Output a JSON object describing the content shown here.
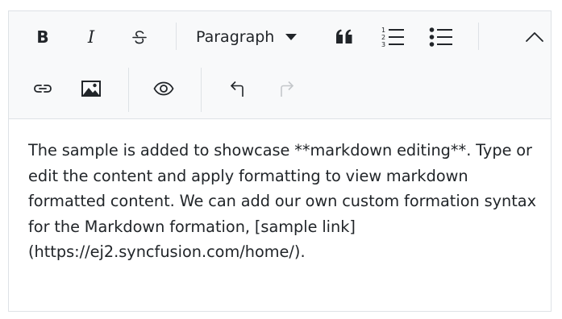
{
  "toolbar": {
    "bold": {
      "icon": "bold-icon",
      "glyph": "B"
    },
    "italic": {
      "icon": "italic-icon",
      "glyph": "I"
    },
    "strikethrough": {
      "icon": "strikethrough-icon"
    },
    "format": {
      "label": "Paragraph"
    },
    "blockquote": {
      "icon": "blockquote-icon"
    },
    "ordered_list": {
      "icon": "ordered-list-icon"
    },
    "unordered_list": {
      "icon": "unordered-list-icon"
    },
    "collapse": {
      "icon": "chevron-up-icon"
    },
    "link": {
      "icon": "link-icon"
    },
    "image": {
      "icon": "image-icon"
    },
    "preview": {
      "icon": "eye-icon"
    },
    "undo": {
      "icon": "undo-icon"
    },
    "redo": {
      "icon": "redo-icon",
      "disabled": true
    }
  },
  "editor": {
    "text": "The sample is added to showcase **markdown editing**. Type or edit the content and apply formatting to view markdown formatted content. We can add our own custom formation syntax for the Markdown formation, [sample link](https://ej2.syncfusion.com/home/)."
  },
  "colors": {
    "toolbar_bg": "#f8f9fa",
    "border": "#dee2e6",
    "text": "#212529",
    "disabled": "#c4c7ca"
  }
}
